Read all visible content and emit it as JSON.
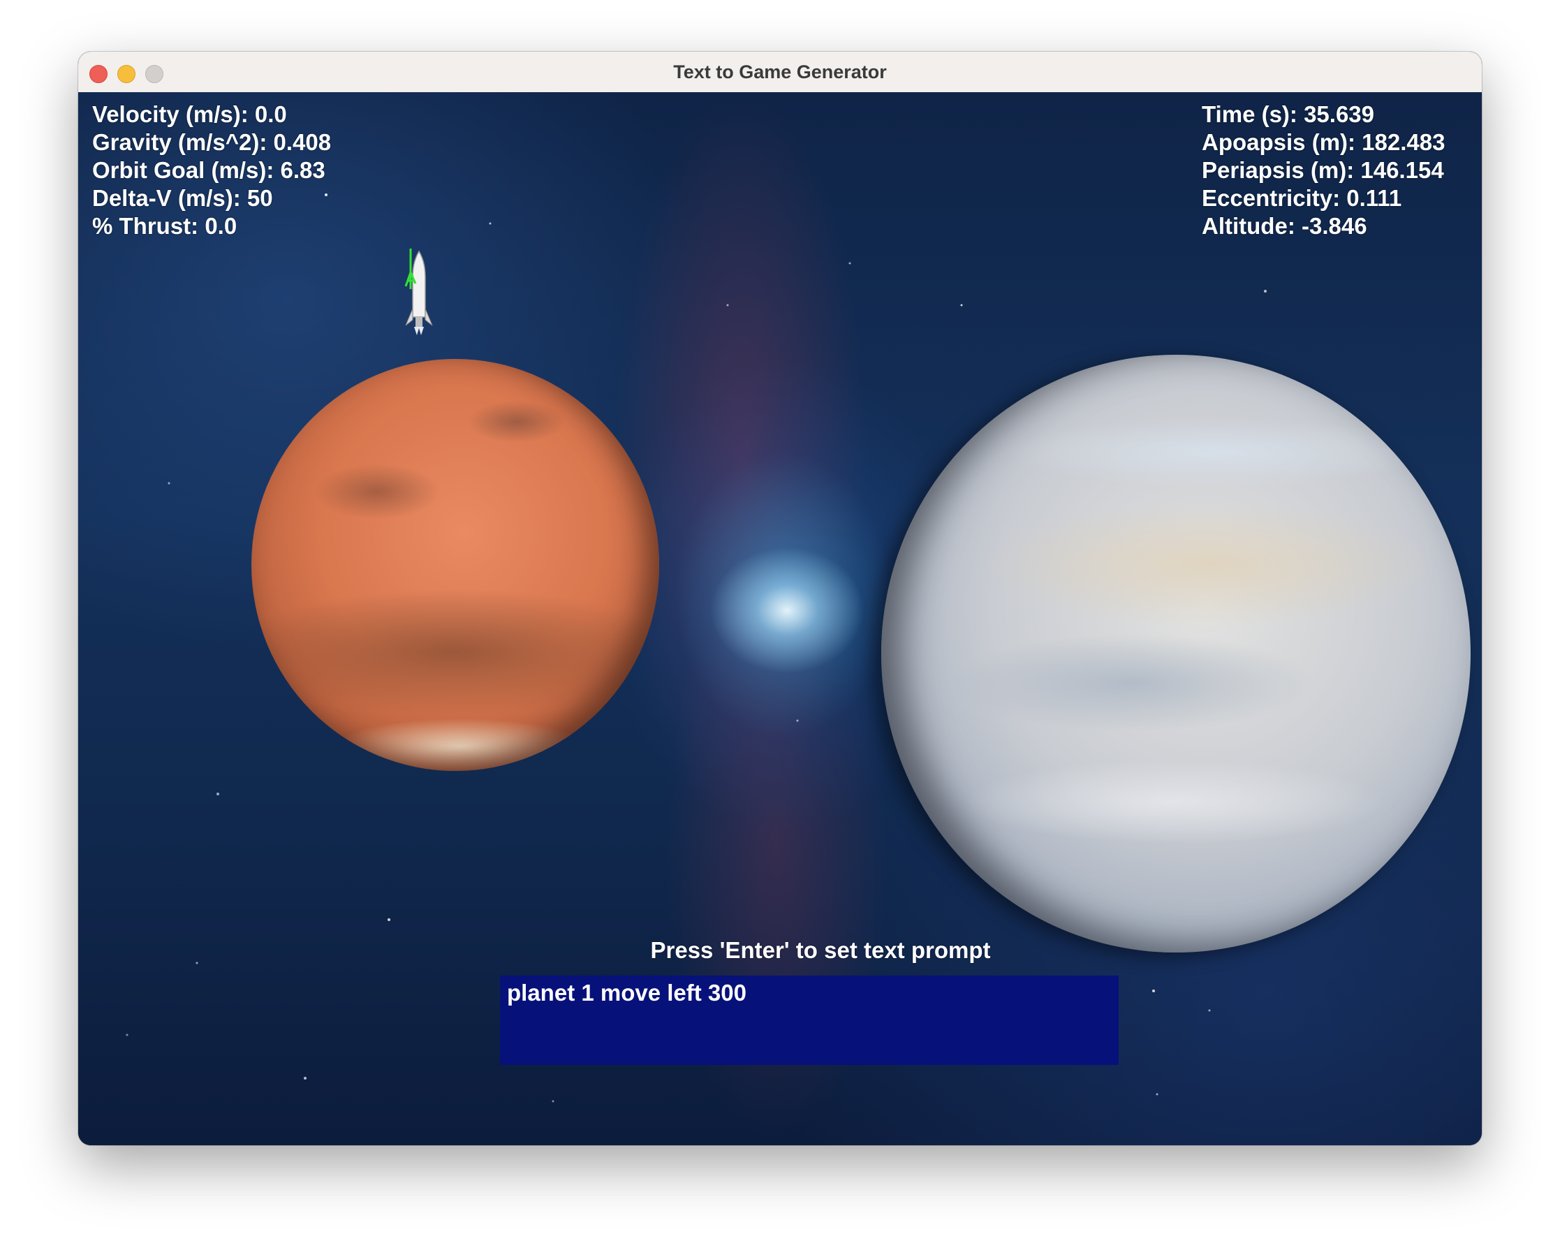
{
  "window": {
    "title": "Text to Game Generator"
  },
  "hud": {
    "left": [
      "Velocity (m/s): 0.0",
      "Gravity (m/s^2): 0.408",
      "Orbit Goal (m/s): 6.83",
      "Delta-V (m/s): 50",
      "% Thrust: 0.0"
    ],
    "right": [
      "Time (s): 35.639",
      "Apoapsis (m): 182.483",
      "Periapsis (m): 146.154",
      "Eccentricity: 0.111",
      "Altitude: -3.846"
    ]
  },
  "prompt": {
    "label": "Press 'Enter' to set text prompt",
    "value": "planet 1 move left 300"
  },
  "colors": {
    "prompt_box": "#07117a",
    "hud_text": "#ffffff",
    "close": "#ee5f57",
    "minimize": "#f6be3a",
    "zoom": "#d3cfcd"
  }
}
